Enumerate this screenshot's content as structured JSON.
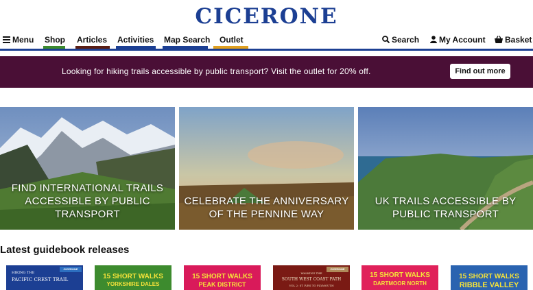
{
  "logo": "CICERONE",
  "nav": {
    "menu": "Menu",
    "shop": "Shop",
    "articles": "Articles",
    "activities": "Activities",
    "map_search": "Map Search",
    "outlet": "Outlet",
    "search": "Search",
    "account": "My Account",
    "basket": "Basket"
  },
  "colors": {
    "brand": "#1c3f93",
    "promo_bg": "#4a0f36",
    "shop": "#3d8b2e",
    "articles": "#5a1e14",
    "activities": "#1c3f93",
    "map_search": "#1c3f93",
    "outlet": "#e0a020"
  },
  "promo": {
    "text": "Looking for hiking trails accessible by public transport? Visit the outlet for 20% off.",
    "button": "Find out more"
  },
  "tiles": [
    {
      "lines": [
        "FIND INTERNATIONAL TRAILS",
        "ACCESSIBLE BY PUBLIC",
        "TRANSPORT"
      ]
    },
    {
      "lines": [
        "CELEBRATE THE ANNIVERSARY",
        "OF THE PENNINE WAY"
      ]
    },
    {
      "lines": [
        "UK TRAILS ACCESSIBLE BY",
        "PUBLIC TRANSPORT"
      ]
    }
  ],
  "latest_title": "Latest guidebook releases",
  "books": [
    {
      "line1": "HIKING THE",
      "line2": "PACIFIC CREST TRAIL",
      "corner": "CICERONE",
      "color": "#1c3f93"
    },
    {
      "line1": "15 SHORT WALKS",
      "line2": "YORKSHIRE DALES",
      "corner": "",
      "color": "#3d8b2e"
    },
    {
      "line1": "15 SHORT WALKS",
      "line2": "PEAK DISTRICT",
      "corner": "",
      "color": "#d91a5a"
    },
    {
      "line1": "WALKING THE",
      "line2": "SOUTH WEST COAST PATH",
      "line3": "VOL 2: ST IVES TO PLYMOUTH",
      "corner": "CICERONE",
      "color": "#7a1a14"
    },
    {
      "line1": "15 SHORT WALKS",
      "line2": "DARTMOOR NORTH",
      "corner": "",
      "color": "#e0215a"
    },
    {
      "line1": "15 SHORT WALKS",
      "line2": "RIBBLE VALLEY",
      "corner": "",
      "color": "#2a63b0"
    }
  ]
}
